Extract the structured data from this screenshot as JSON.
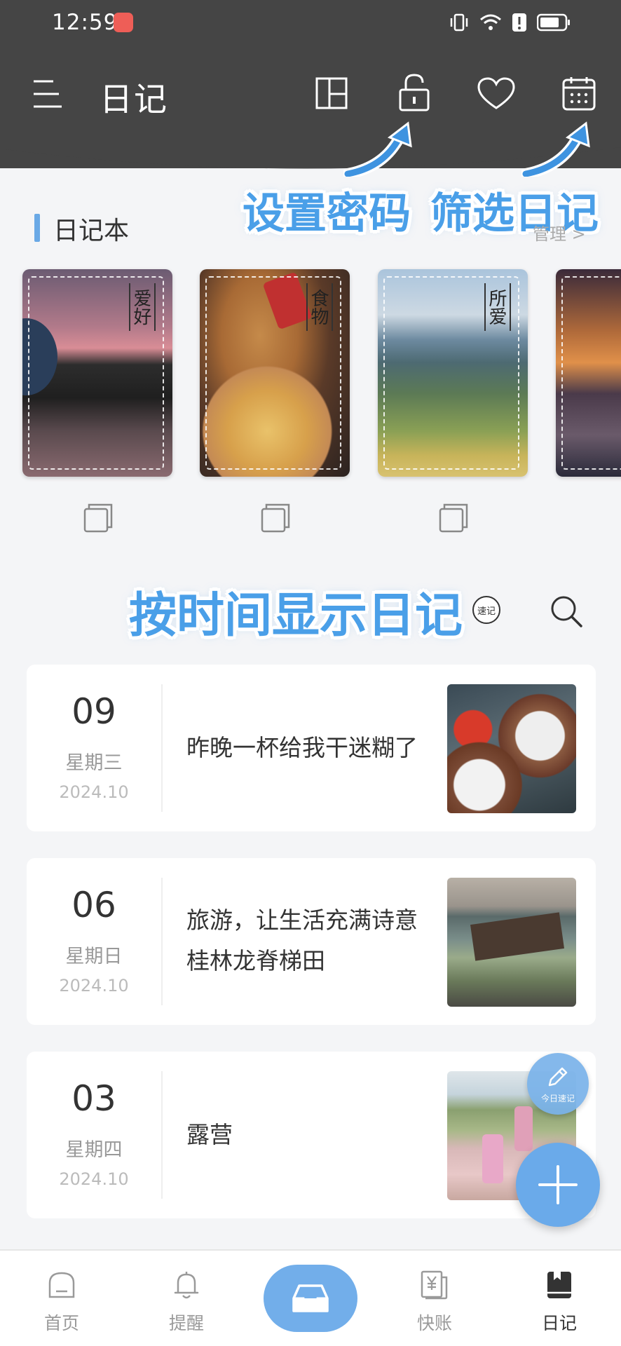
{
  "status": {
    "time": "12:59"
  },
  "header": {
    "title": "日记"
  },
  "callouts": {
    "password": "设置密码",
    "filter": "筛选日记",
    "timeline": "按时间显示日记"
  },
  "notebooks": {
    "title": "日记本",
    "manage": "管理 >",
    "items": [
      {
        "tag": "爱好"
      },
      {
        "tag": "食物"
      },
      {
        "tag": "所爱"
      },
      {
        "tag": ""
      }
    ]
  },
  "timeline": {
    "quick_badge": "速记"
  },
  "entries": [
    {
      "day": "09",
      "weekday": "星期三",
      "ym": "2024.10",
      "text": "昨晚一杯给我干迷糊了"
    },
    {
      "day": "06",
      "weekday": "星期日",
      "ym": "2024.10",
      "text": "旅游，让生活充满诗意桂林龙脊梯田"
    },
    {
      "day": "03",
      "weekday": "星期四",
      "ym": "2024.10",
      "text": "露营"
    }
  ],
  "fab": {
    "quick_note_label": "今日速记"
  },
  "bottom_nav": {
    "home": "首页",
    "remind": "提醒",
    "ledger": "快账",
    "diary": "日记"
  },
  "colors": {
    "accent": "#6aaaea",
    "header_bg": "#454545",
    "callout": "#4a9fe8"
  }
}
